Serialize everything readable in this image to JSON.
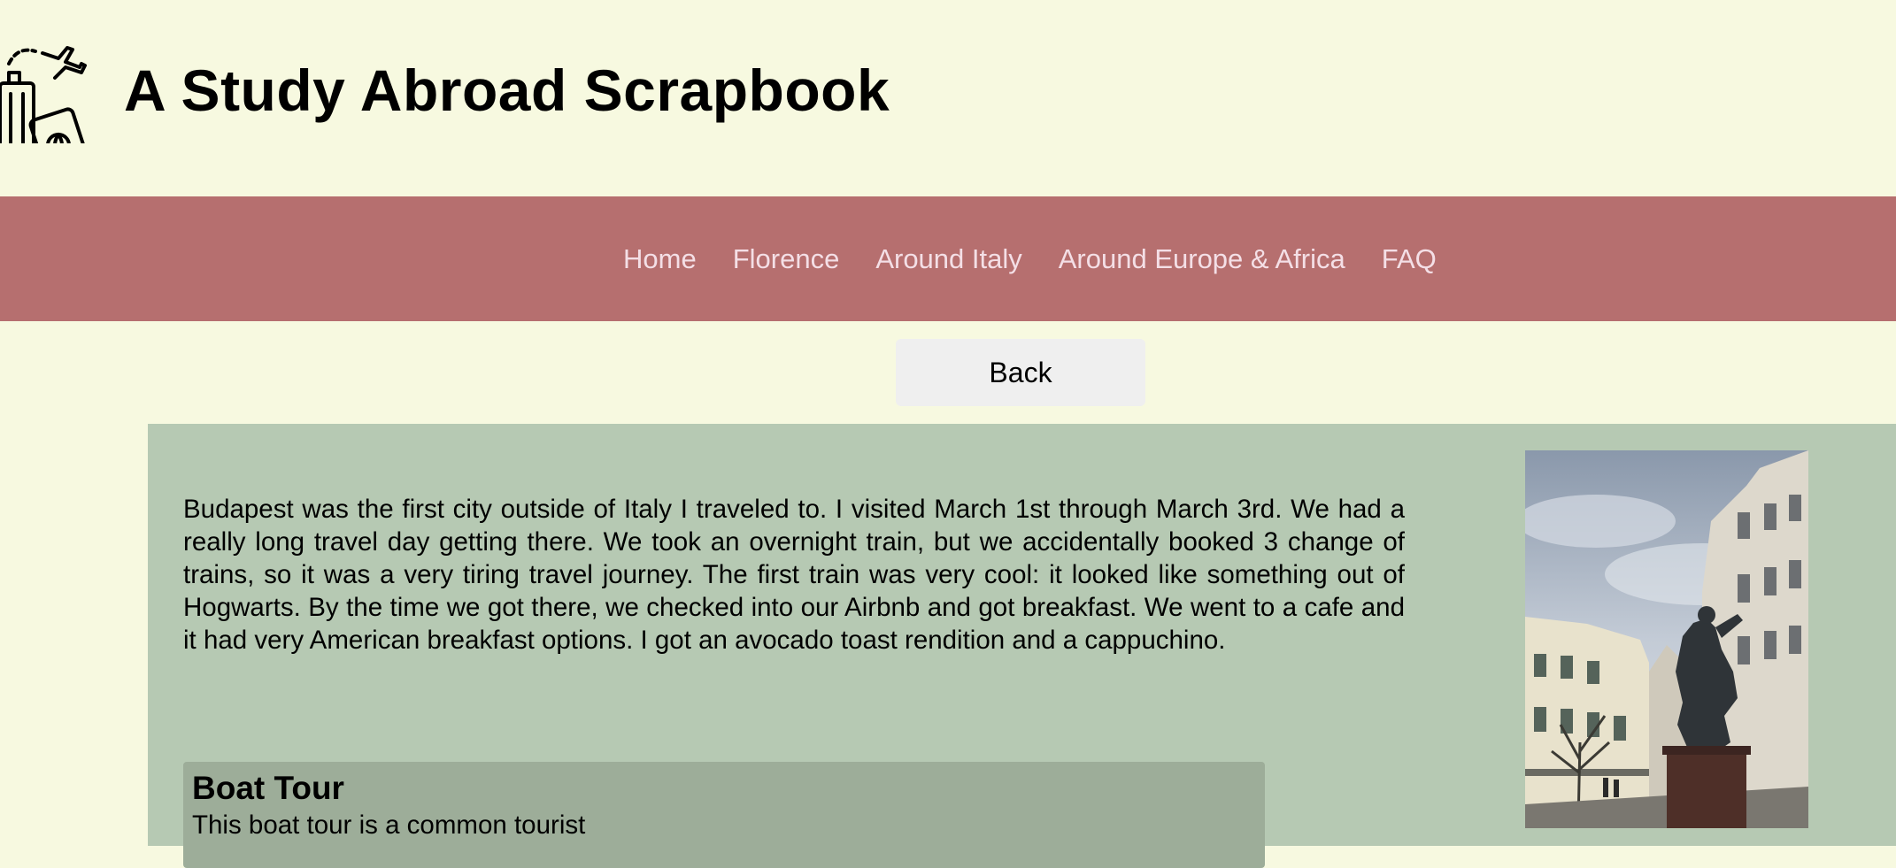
{
  "header": {
    "title": "A Study Abroad Scrapbook",
    "logo_icon": "travel-luggage-passport-icon"
  },
  "nav": {
    "items": [
      {
        "label": "Home"
      },
      {
        "label": "Florence"
      },
      {
        "label": "Around Italy"
      },
      {
        "label": "Around Europe & Africa"
      },
      {
        "label": "FAQ"
      }
    ]
  },
  "back_button": {
    "label": "Back"
  },
  "content": {
    "intro": "Budapest was the first city outside of Italy I traveled to. I visited March 1st through March 3rd. We had a really long travel day getting there. We took an overnight train, but we accidentally booked 3 change of trains, so it was a very tiring travel journey. The first train was very cool: it looked like something out of Hogwarts. By the time we got there, we checked into our Airbnb and got breakfast. We went to a cafe and it had very American breakfast options. I got an avocado toast rendition and a cappuchino.",
    "photo_alt": "Statue on a Budapest street"
  },
  "boat_tour": {
    "title": "Boat Tour",
    "text": "This boat tour is a common tourist"
  },
  "colors": {
    "page_bg": "#f7f9e0",
    "nav_bg": "#b66f6f",
    "nav_text": "#f4dfe6",
    "panel_bg": "#b6c9b3",
    "card_bg": "#9dad99",
    "button_bg": "#efefef"
  }
}
